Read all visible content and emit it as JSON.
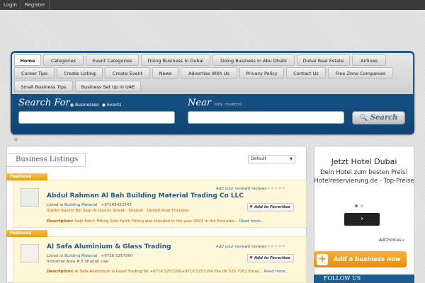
{
  "topbar": {
    "login": "Login",
    "register": "Register"
  },
  "nav": {
    "items": [
      "Home",
      "Categories",
      "Event Categories",
      "Doing Business In Dubai",
      "Doing Business In Abu Dhabi",
      "Dubai Real Estate",
      "Airlines",
      "Career Tips",
      "Create Listing",
      "Create Event",
      "News",
      "Advertise With Us",
      "Privacy Policy",
      "Contact Us",
      "Free Zone Companies",
      "Small Business Tips",
      "Business Set Up in UAE"
    ]
  },
  "search": {
    "for_label": "Search For",
    "opt_businesses": "Businesses",
    "opt_events": "Events",
    "near_label": "Near",
    "near_hint": "(city, country)",
    "button": "Search"
  },
  "listings": {
    "title": "Business Listings",
    "sort": "Default",
    "items": [
      {
        "badge": "Featured",
        "name": "Abdul Rahman Al Bah Building Material Trading Co LLC",
        "review_link": "Add your review",
        "reviews": "0 reviews",
        "listed_in": "Listed in",
        "category": "Building Material",
        "phone": "+97165432542",
        "address": "Sheikh Rashid Bin Saqr Al Qasimi Street - Sharjah - United Arab Emirates",
        "fav": "Add to Favorites",
        "desc_label": "Description:",
        "desc": "Safe Patch Fitting Safe Patch Fitting was founded in the year 2001 in the Emirates...",
        "more": "Read more..."
      },
      {
        "badge": "Featured",
        "name": "Al Safa Aluminium & Glass Trading",
        "review_link": "Add your review",
        "reviews": "0 reviews",
        "listed_in": "Listed in",
        "category": "Building Material",
        "phone": "+9716 5257260",
        "address": "Industrial Area # 5 Sharjah Uae",
        "fav": "Add to Favorites",
        "desc_label": "Description:",
        "desc": "Al Safa Aluminium & Glass Trading Tel +9716 5257260+9716 5257260 Fax 06 525 7261 Email...",
        "more": "Read more..."
      }
    ]
  },
  "sidebar": {
    "ad_title": "Jetzt Hotel Dubai",
    "ad_text": "Dein Hotel zum besten Preis! Hotelreservierung.de - Top-Preise",
    "ad_choices": "AdChoices",
    "add_business": "Add a business now",
    "follow": "FOLLOW US"
  }
}
